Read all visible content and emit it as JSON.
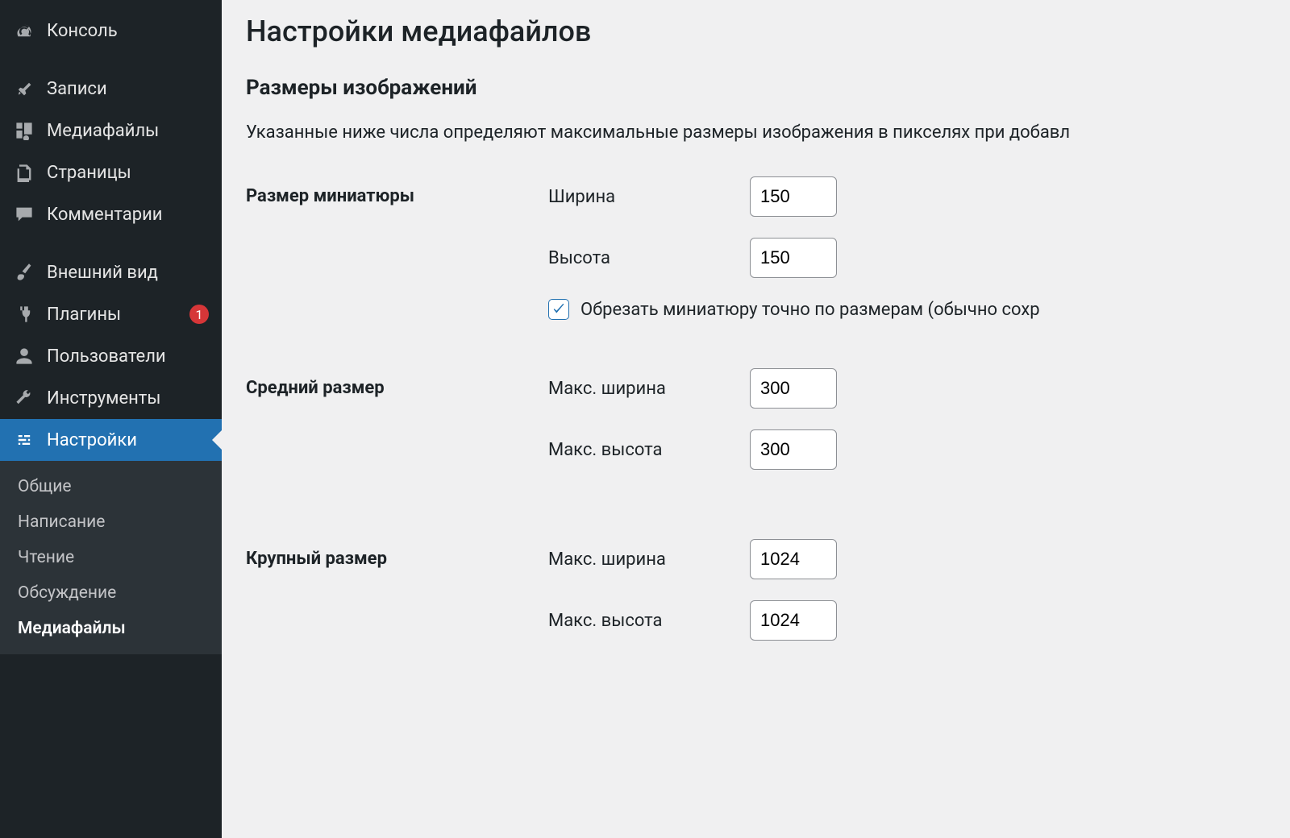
{
  "sidebar": {
    "items": [
      {
        "label": "Консоль",
        "icon": "dashboard"
      },
      {
        "label": "Записи",
        "icon": "pin"
      },
      {
        "label": "Медиафайлы",
        "icon": "media"
      },
      {
        "label": "Страницы",
        "icon": "pages"
      },
      {
        "label": "Комментарии",
        "icon": "comment"
      },
      {
        "label": "Внешний вид",
        "icon": "brush"
      },
      {
        "label": "Плагины",
        "icon": "plug",
        "badge": "1"
      },
      {
        "label": "Пользователи",
        "icon": "user"
      },
      {
        "label": "Инструменты",
        "icon": "wrench"
      },
      {
        "label": "Настройки",
        "icon": "settings",
        "current": true
      }
    ],
    "submenu": [
      {
        "label": "Общие"
      },
      {
        "label": "Написание"
      },
      {
        "label": "Чтение"
      },
      {
        "label": "Обсуждение"
      },
      {
        "label": "Медиафайлы",
        "current": true
      }
    ]
  },
  "page": {
    "title": "Настройки медиафайлов",
    "section_title": "Размеры изображений",
    "description": "Указанные ниже числа определяют максимальные размеры изображения в пикселях при добавл"
  },
  "thumbnail": {
    "row_label": "Размер миниатюры",
    "width_label": "Ширина",
    "width_value": "150",
    "height_label": "Высота",
    "height_value": "150",
    "crop_checked": true,
    "crop_label": "Обрезать миниатюру точно по размерам (обычно сохр"
  },
  "medium": {
    "row_label": "Средний размер",
    "width_label": "Макс. ширина",
    "width_value": "300",
    "height_label": "Макс. высота",
    "height_value": "300"
  },
  "large": {
    "row_label": "Крупный размер",
    "width_label": "Макс. ширина",
    "width_value": "1024",
    "height_label": "Макс. высота",
    "height_value": "1024"
  }
}
